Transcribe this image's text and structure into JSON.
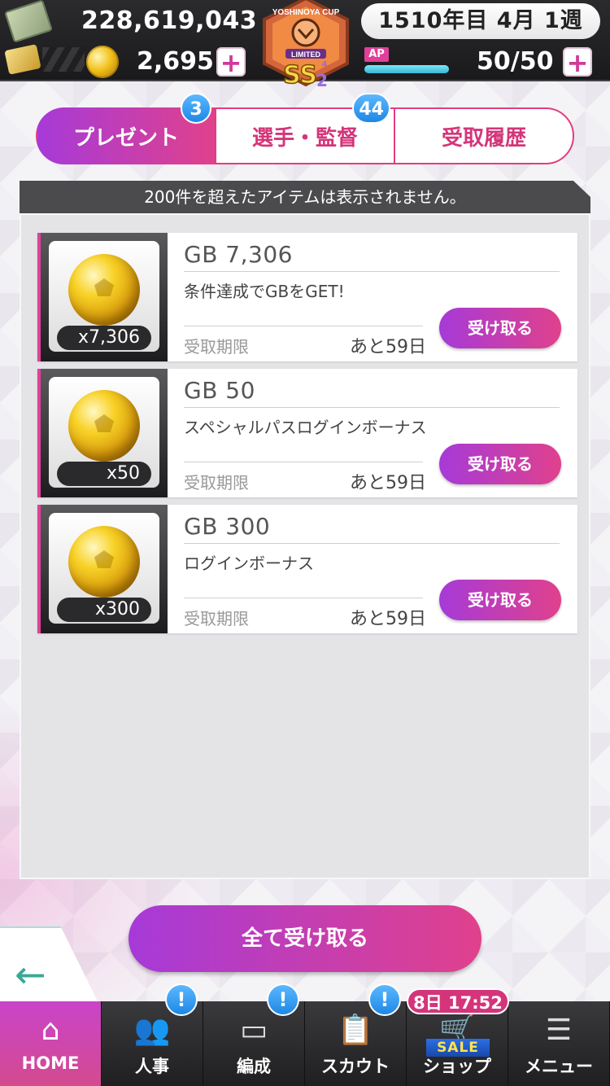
{
  "header": {
    "money": "228,619,043",
    "gb": "2,695",
    "date": "1510年目 4月 1週",
    "ap_label": "AP",
    "ap_value": "50/50",
    "ap_fill": 1.0,
    "plus": "+",
    "emblem": {
      "cup_text": "YOSHINOYA CUP",
      "limited": "LIMITED",
      "ss": "SS",
      "ss_level": "2",
      "side_char": "4"
    }
  },
  "tabs": [
    {
      "label": "プレゼント",
      "count": "3",
      "active": true
    },
    {
      "label": "選手・監督",
      "count": "44",
      "active": false
    },
    {
      "label": "受取履歴",
      "count": "",
      "active": false
    }
  ],
  "notice": "200件を超えたアイテムは表示されません。",
  "items": [
    {
      "qty": "x7,306",
      "title": "GB 7,306",
      "desc": "条件達成でGBをGET!",
      "deadline_label": "受取期限",
      "deadline_value": "あと59日",
      "button": "受け取る"
    },
    {
      "qty": "x50",
      "title": "GB 50",
      "desc": "スペシャルパスログインボーナス",
      "deadline_label": "受取期限",
      "deadline_value": "あと59日",
      "button": "受け取る"
    },
    {
      "qty": "x300",
      "title": "GB 300",
      "desc": "ログインボーナス",
      "deadline_label": "受取期限",
      "deadline_value": "あと59日",
      "button": "受け取る"
    }
  ],
  "receive_all": "全て受け取る",
  "back_glyph": "←",
  "nav": [
    {
      "label": "HOME",
      "icon": "home-icon",
      "glyph": "⌂",
      "alert": ""
    },
    {
      "label": "人事",
      "icon": "people-icon",
      "glyph": "👥",
      "alert": "!"
    },
    {
      "label": "編成",
      "icon": "pitch-icon",
      "glyph": "▭",
      "alert": "!"
    },
    {
      "label": "スカウト",
      "icon": "scout-icon",
      "glyph": "📋",
      "alert": "!"
    },
    {
      "label": "ショップ",
      "icon": "cart-icon",
      "glyph": "🛒",
      "alert": "",
      "sale": "SALE"
    },
    {
      "label": "メニュー",
      "icon": "menu-icon",
      "glyph": "☰",
      "alert": ""
    }
  ],
  "sale_timer": "8日 17:52",
  "colors": {
    "accent_start": "#a63ad8",
    "accent_end": "#e0418c",
    "badge_blue": "#1e88e5"
  }
}
